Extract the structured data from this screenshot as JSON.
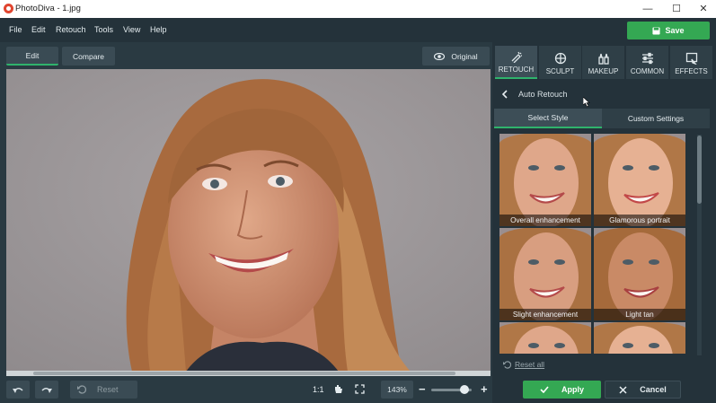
{
  "window": {
    "title": "PhotoDiva - 1.jpg",
    "controls": [
      "—",
      "☐",
      "✕"
    ]
  },
  "menu": [
    "File",
    "Edit",
    "Retouch",
    "Tools",
    "View",
    "Help"
  ],
  "save_label": "Save",
  "view_tabs": {
    "edit": "Edit",
    "compare": "Compare"
  },
  "original_label": "Original",
  "bottom": {
    "one_to_one": "1:1",
    "reset": "Reset",
    "zoom": "143%",
    "zoom_level": 0.72
  },
  "right_tabs": [
    {
      "label": "RETOUCH",
      "icon": "retouch-icon",
      "active": true
    },
    {
      "label": "SCULPT",
      "icon": "sculpt-icon",
      "active": false
    },
    {
      "label": "MAKEUP",
      "icon": "makeup-icon",
      "active": false
    },
    {
      "label": "COMMON",
      "icon": "sliders-icon",
      "active": false
    },
    {
      "label": "EFFECTS",
      "icon": "effects-icon",
      "active": false
    }
  ],
  "panel": {
    "header": "Auto Retouch",
    "subtabs": {
      "select_style": "Select Style",
      "custom": "Custom Settings"
    },
    "presets": [
      {
        "label": "Overall enhancement"
      },
      {
        "label": "Glamorous portrait"
      },
      {
        "label": "Slight enhancement"
      },
      {
        "label": "Light tan"
      },
      {
        "label": ""
      },
      {
        "label": ""
      }
    ],
    "reset_all": "Reset all",
    "apply": "Apply",
    "cancel": "Cancel"
  },
  "colors": {
    "accent": "#34a853",
    "bg": "#24323a",
    "panel": "#2f3f47"
  }
}
